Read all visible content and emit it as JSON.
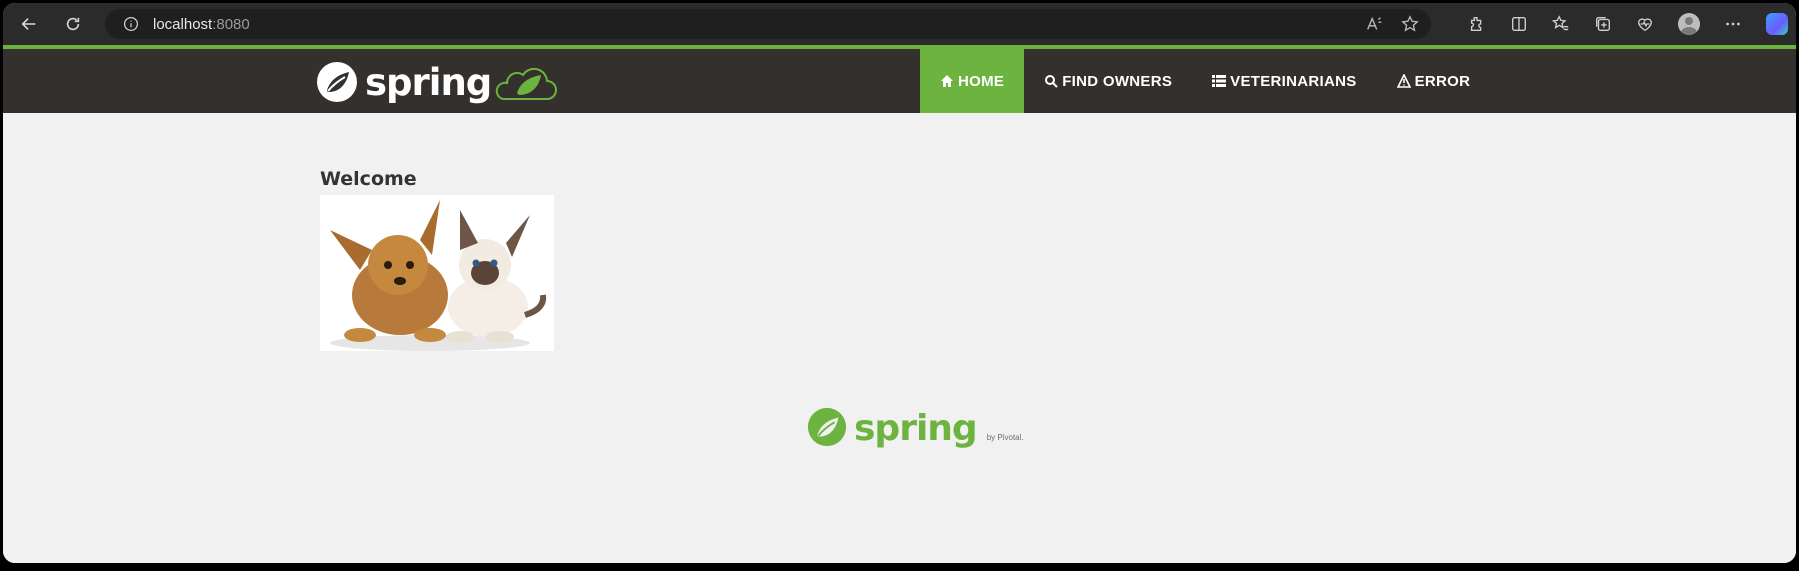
{
  "browser": {
    "url_host": "localhost",
    "url_port": ":8080"
  },
  "site": {
    "brand": "spring",
    "nav": [
      {
        "label": "HOME",
        "icon": "home-icon",
        "active": true
      },
      {
        "label": "FIND OWNERS",
        "icon": "search-icon",
        "active": false
      },
      {
        "label": "VETERINARIANS",
        "icon": "list-icon",
        "active": false
      },
      {
        "label": "ERROR",
        "icon": "warning-icon",
        "active": false
      }
    ],
    "accent_color": "#6db33f",
    "nav_bg_color": "#34302d"
  },
  "main": {
    "heading": "Welcome",
    "image_alt": "pets"
  },
  "footer": {
    "brand": "spring",
    "by": "by Pivotal."
  }
}
